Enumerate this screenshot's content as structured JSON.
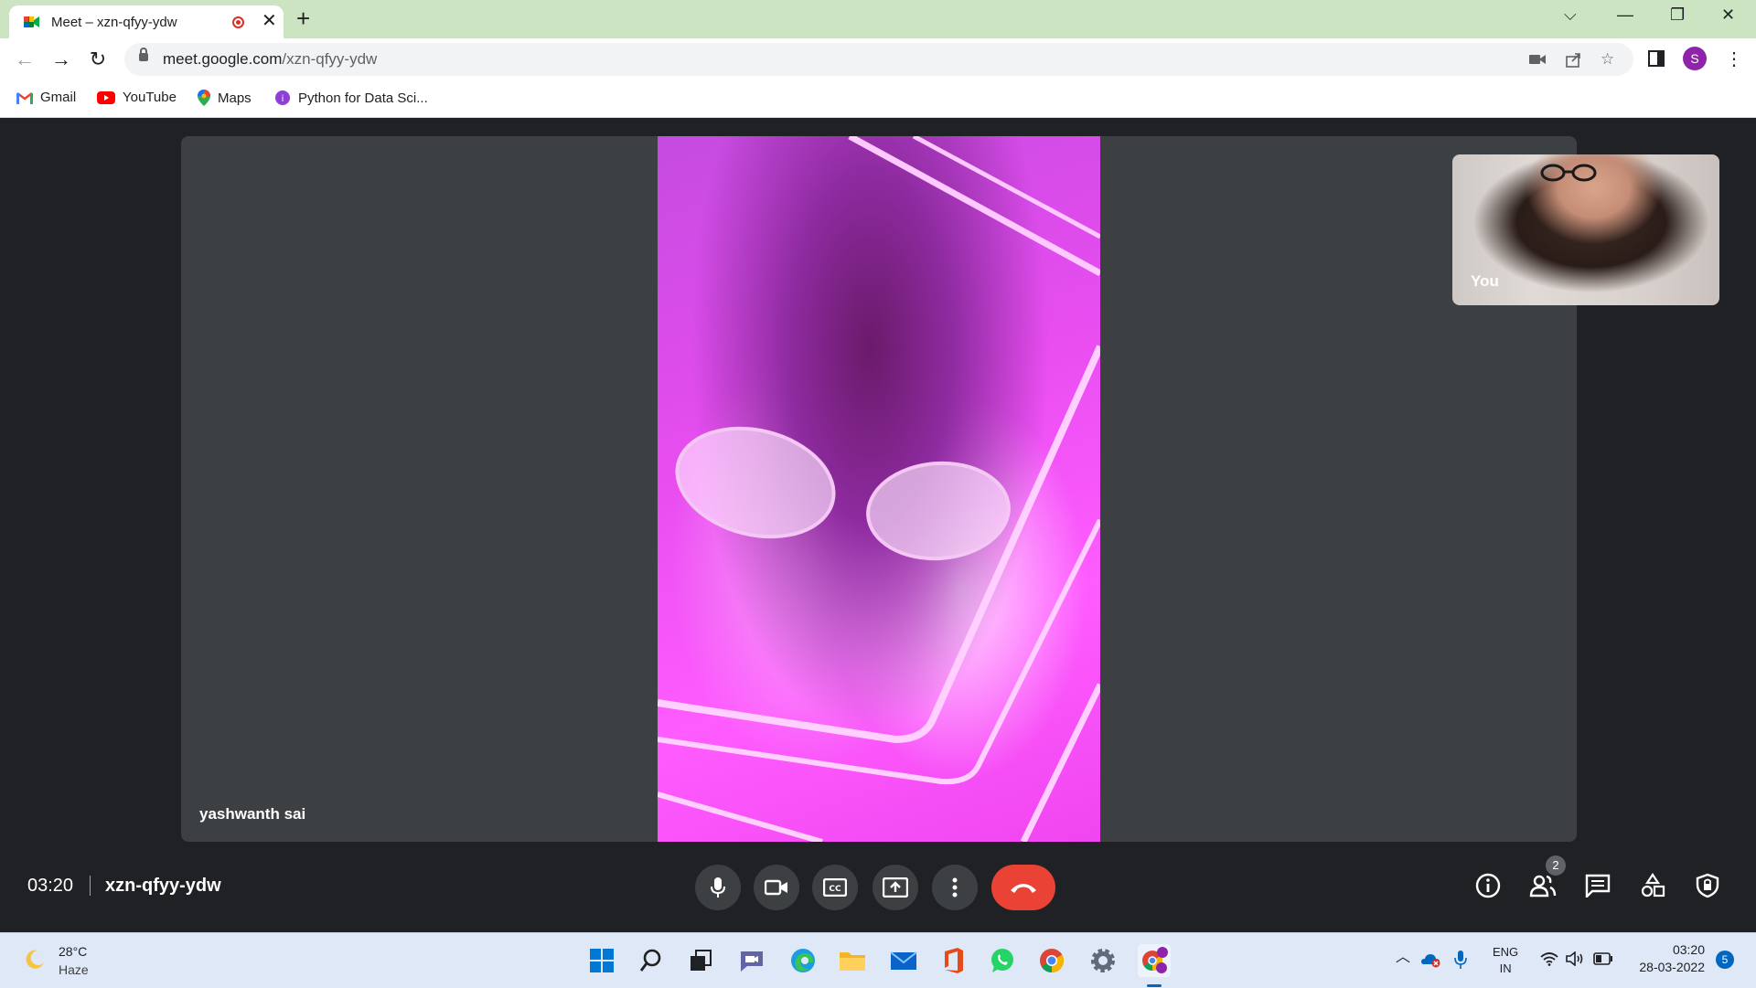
{
  "browser": {
    "tab_title": "Meet – xzn-qfyy-ydw",
    "url_host": "meet.google.com",
    "url_path": "/xzn-qfyy-ydw",
    "profile_initial": "S",
    "bookmarks": [
      {
        "label": "Gmail",
        "icon": "gmail-icon"
      },
      {
        "label": "YouTube",
        "icon": "youtube-icon"
      },
      {
        "label": "Maps",
        "icon": "maps-icon"
      },
      {
        "label": "Python for Data Sci...",
        "icon": "python-course-icon"
      }
    ]
  },
  "meet": {
    "main_participant": "yashwanth sai",
    "self_label": "You",
    "time": "03:20",
    "meeting_code": "xzn-qfyy-ydw",
    "participant_count": "2",
    "controls": [
      "mic-icon",
      "camera-icon",
      "captions-icon",
      "present-icon",
      "more-options-icon",
      "hangup-icon"
    ],
    "right_controls": [
      "info-icon",
      "people-icon",
      "chat-icon",
      "activities-icon",
      "host-controls-icon"
    ],
    "colors": {
      "hangup": "#ea4335",
      "control_bg": "#3c4043",
      "bar_bg": "#202124"
    }
  },
  "taskbar": {
    "weather_temp": "28°C",
    "weather_desc": "Haze",
    "lang_line1": "ENG",
    "lang_line2": "IN",
    "clock_time": "03:20",
    "clock_date": "28-03-2022",
    "notification_count": "5",
    "apps": [
      "start-icon",
      "search-icon",
      "task-view-icon",
      "teams-chat-icon",
      "edge-icon",
      "file-explorer-icon",
      "mail-icon",
      "office-icon",
      "whatsapp-icon",
      "chrome-icon",
      "settings-icon",
      "chrome-profile-icon"
    ]
  }
}
